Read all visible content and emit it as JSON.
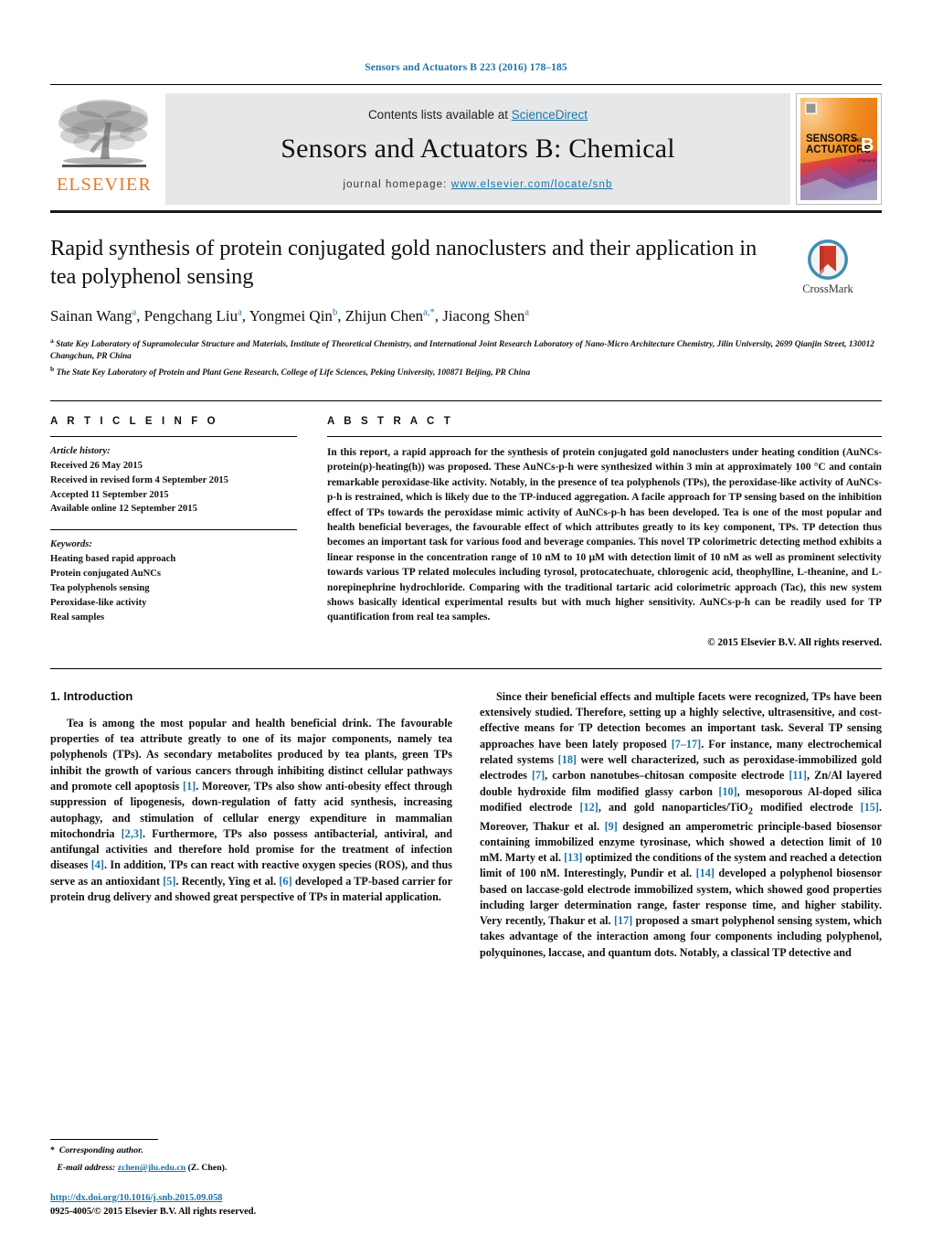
{
  "running_head": "Sensors and Actuators B 223 (2016) 178–185",
  "masthead": {
    "contents_prefix": "Contents lists available at ",
    "sciencedirect": "ScienceDirect",
    "journal_name": "Sensors and Actuators B: Chemical",
    "homepage_prefix": "journal homepage: ",
    "homepage_url": "www.elsevier.com/locate/snb",
    "elsevier_wordmark": "ELSEVIER",
    "cover": {
      "line1": "SENSORS",
      "line1b": "and",
      "line2": "ACTUATORS",
      "letter": "B",
      "sub": "Chemical"
    },
    "colors": {
      "link": "#1b74a8",
      "elsevier_orange": "#E87722",
      "band_grey": "#e6e7e8"
    }
  },
  "article": {
    "title": "Rapid synthesis of protein conjugated gold nanoclusters and their application in tea polyphenol sensing",
    "authors_html": "Sainan Wang<sup>a</sup>, Pengchang Liu<sup>a</sup>, Yongmei Qin<sup>b</sup>, Zhijun Chen<sup>a,*</sup>, Jiacong Shen<sup>a</sup>",
    "affiliation_a": "State Key Laboratory of Supramolecular Structure and Materials, Institute of Theoretical Chemistry, and International Joint Research Laboratory of Nano-Micro Architecture Chemistry, Jilin University, 2699 Qianjin Street, 130012 Changchun, PR China",
    "affiliation_b": "The State Key Laboratory of Protein and Plant Gene Research, College of Life Sciences, Peking University, 100871 Beijing, PR China",
    "crossmark_label": "CrossMark"
  },
  "info": {
    "heading": "A R T I C L E    I N F O",
    "history_label": "Article history:",
    "history": [
      "Received 26 May 2015",
      "Received in revised form 4 September 2015",
      "Accepted 11 September 2015",
      "Available online 12 September 2015"
    ],
    "keywords_label": "Keywords:",
    "keywords": [
      "Heating based rapid approach",
      "Protein conjugated AuNCs",
      "Tea polyphenols sensing",
      "Peroxidase-like activity",
      "Real samples"
    ]
  },
  "abstract": {
    "heading": "A B S T R A C T",
    "text": "In this report, a rapid approach for the synthesis of protein conjugated gold nanoclusters under heating condition (AuNCs-protein(p)-heating(h)) was proposed. These AuNCs-p-h were synthesized within 3 min at approximately 100 °C and contain remarkable peroxidase-like activity. Notably, in the presence of tea polyphenols (TPs), the peroxidase-like activity of AuNCs-p-h is restrained, which is likely due to the TP-induced aggregation. A facile approach for TP sensing based on the inhibition effect of TPs towards the peroxidase mimic activity of AuNCs-p-h has been developed. Tea is one of the most popular and health beneficial beverages, the favourable effect of which attributes greatly to its key component, TPs. TP detection thus becomes an important task for various food and beverage companies. This novel TP colorimetric detecting method exhibits a linear response in the concentration range of 10 nM to 10 μM with detection limit of 10 nM as well as prominent selectivity towards various TP related molecules including tyrosol, protocatechuate, chlorogenic acid, theophylline, L-theanine, and L-norepinephrine hydrochloride. Comparing with the traditional tartaric acid colorimetric approach (Tac), this new system shows basically identical experimental results but with much higher sensitivity. AuNCs-p-h can be readily used for TP quantification from real tea samples.",
    "copyright": "© 2015 Elsevier B.V. All rights reserved."
  },
  "intro": {
    "heading": "1. Introduction",
    "left_paragraph_html": "Tea is among the most popular and health beneficial drink. The favourable properties of tea attribute greatly to one of its major components, namely tea polyphenols (TPs). As secondary metabolites produced by tea plants, green TPs inhibit the growth of various cancers through inhibiting distinct cellular pathways and promote cell apoptosis <span class=\"ref\">[1]</span>. Moreover, TPs also show anti-obesity effect through suppression of lipogenesis, down-regulation of fatty acid synthesis, increasing autophagy, and stimulation of cellular energy expenditure in mammalian mitochondria <span class=\"ref\">[2,3]</span>. Furthermore, TPs also possess antibacterial, antiviral, and antifungal activities and therefore hold promise for the treatment of infection diseases <span class=\"ref\">[4]</span>. In addition, TPs can react with reactive oxygen species (ROS), and thus serve as an antioxidant <span class=\"ref\">[5]</span>. Recently, Ying et al. <span class=\"ref\">[6]</span> developed a TP-based carrier for protein drug delivery and showed great perspective of TPs in material application.",
    "right_paragraph_html": "Since their beneficial effects and multiple facets were recognized, TPs have been extensively studied. Therefore, setting up a highly selective, ultrasensitive, and cost-effective means for TP detection becomes an important task. Several TP sensing approaches have been lately proposed <span class=\"ref\">[7–17]</span>. For instance, many electrochemical related systems <span class=\"ref\">[18]</span> were well characterized, such as peroxidase-immobilized gold electrodes <span class=\"ref\">[7]</span>, carbon nanotubes–chitosan composite electrode <span class=\"ref\">[11]</span>, Zn/Al layered double hydroxide film modified glassy carbon <span class=\"ref\">[10]</span>, mesoporous Al-doped silica modified electrode <span class=\"ref\">[12]</span>, and gold nanoparticles/TiO<sub>2</sub> modified electrode <span class=\"ref\">[15]</span>. Moreover, Thakur et al. <span class=\"ref\">[9]</span> designed an amperometric principle-based biosensor containing immobilized enzyme tyrosinase, which showed a detection limit of 10 mM. Marty et al. <span class=\"ref\">[13]</span> optimized the conditions of the system and reached a detection limit of 100 nM. Interestingly, Pundir et al. <span class=\"ref\">[14]</span> developed a polyphenol biosensor based on laccase-gold electrode immobilized system, which showed good properties including larger determination range, faster response time, and higher stability. Very recently, Thakur et al. <span class=\"ref\">[17]</span> proposed a smart polyphenol sensing system, which takes advantage of the interaction among four components including polyphenol, polyquinones, laccase, and quantum dots. Notably, a classical TP detective and"
  },
  "footnote": {
    "corresponding": "Corresponding author.",
    "email_label": "E-mail address:",
    "email": "zchen@jlu.edu.cn",
    "email_suffix": "(Z. Chen)."
  },
  "footer": {
    "doi": "http://dx.doi.org/10.1016/j.snb.2015.09.058",
    "issn_line": "0925-4005/© 2015 Elsevier B.V. All rights reserved."
  }
}
